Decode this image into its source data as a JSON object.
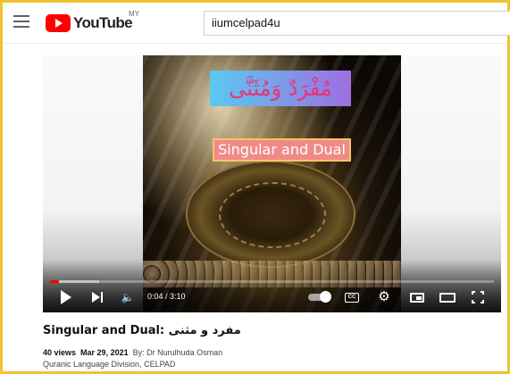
{
  "header": {
    "logo_text": "YouTube",
    "logo_country": "MY",
    "search_value": "iiumcelpad4u"
  },
  "thumbnail": {
    "arabic_title": "مُفْرَدٌ وَمُثَنَّى",
    "subtitle": "Singular and Dual"
  },
  "player": {
    "current_time": "0:04",
    "duration": "3:10",
    "time_display": "0:04 / 3:10",
    "progress_fraction": 0.021,
    "buffered_fraction": 0.11,
    "cc_label": "CC"
  },
  "video": {
    "title": "Singular and Dual: مفرد و مثنى",
    "views": "40 views",
    "date": "Mar 29, 2021",
    "by_line": "By: Dr Nurulhuda Osman",
    "channel_line": "Quranic Language Division, CELPAD"
  },
  "colors": {
    "frame": "#f1c232",
    "brand_red": "#ff0000",
    "arabic_text": "#e8337a",
    "subtitle_bg": "#f08a86"
  },
  "icons": [
    "menu-icon",
    "youtube-logo-icon",
    "play-icon",
    "next-icon",
    "volume-icon",
    "autoplay-toggle-icon",
    "captions-icon",
    "settings-gear-icon",
    "miniplayer-icon",
    "theater-mode-icon",
    "fullscreen-icon"
  ]
}
